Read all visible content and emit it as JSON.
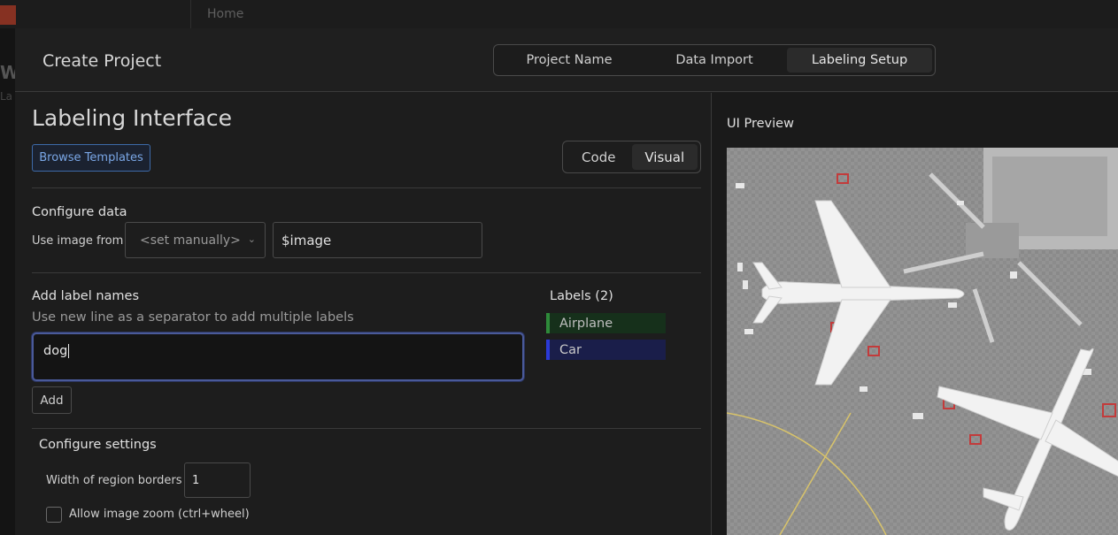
{
  "background": {
    "breadcrumb": "Home",
    "side_letter": "W",
    "side_sub": "La"
  },
  "modal": {
    "title": "Create Project",
    "steps": [
      {
        "label": "Project Name",
        "active": false
      },
      {
        "label": "Data Import",
        "active": false
      },
      {
        "label": "Labeling Setup",
        "active": true
      }
    ]
  },
  "labeling": {
    "title": "Labeling Interface",
    "browse_templates": "Browse Templates",
    "view_toggle": {
      "code": "Code",
      "visual": "Visual",
      "active": "Visual"
    },
    "configure_data": {
      "title": "Configure data",
      "use_image_from_label": "Use image from",
      "source_select_value": "<set manually>",
      "source_value": "$image"
    },
    "add_labels": {
      "title": "Add label names",
      "help": "Use new line as a separator to add multiple labels",
      "textarea_value": "dog",
      "add_button": "Add"
    },
    "labels": {
      "title": "Labels (2)",
      "items": [
        {
          "name": "Airplane",
          "color": "#2e8a3a"
        },
        {
          "name": "Car",
          "color": "#2b3ad6"
        }
      ]
    },
    "settings": {
      "title": "Configure settings",
      "width_label": "Width of region borders",
      "width_value": "1",
      "zoom_label": "Allow image zoom (ctrl+wheel)",
      "zoom_checked": false
    }
  },
  "preview": {
    "title": "UI Preview"
  },
  "colors": {
    "accent": "#7aa7e6",
    "focus_border": "#4a5a9a"
  }
}
